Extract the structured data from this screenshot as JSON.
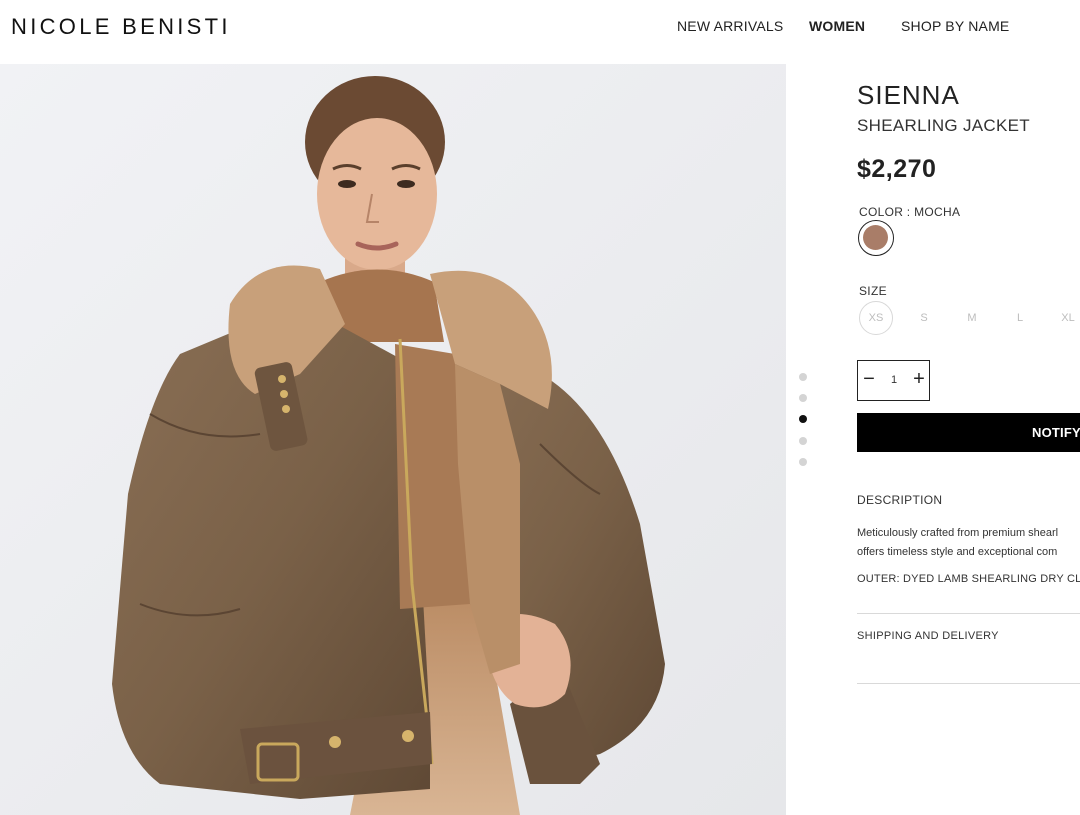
{
  "brand": {
    "logo_text": "NICOLE BENISTI"
  },
  "nav": {
    "items": [
      "NEW ARRIVALS",
      "WOMEN",
      "SHOP BY NAME"
    ],
    "active": "WOMEN"
  },
  "gallery": {
    "image_count": 5,
    "active_index": 2
  },
  "product": {
    "name": "SIENNA",
    "subtitle": "SHEARLING JACKET",
    "price": "$2,270",
    "color_label": "COLOR : MOCHA",
    "color_swatch": "#a97d68",
    "size_label": "SIZE",
    "sizes": [
      "XS",
      "S",
      "M",
      "L",
      "XL"
    ],
    "selected_size": "XS",
    "quantity": {
      "minus": "−",
      "value": "1",
      "plus": "+"
    },
    "notify_label": "NOTIFY",
    "description_heading": "DESCRIPTION",
    "description_line1": "Meticulously crafted from premium shearl",
    "description_line2": "offers timeless style and exceptional com",
    "outer_text": "OUTER: DYED LAMB SHEARLING DRY CLE",
    "shipping_heading": "SHIPPING AND DELIVERY"
  },
  "colors": {
    "notify_bg": "#000000",
    "jacket": "#7a6148",
    "shearling": "#c8a07a",
    "page_bg": "#ffffff",
    "photo_bg": "#eeeff2"
  }
}
